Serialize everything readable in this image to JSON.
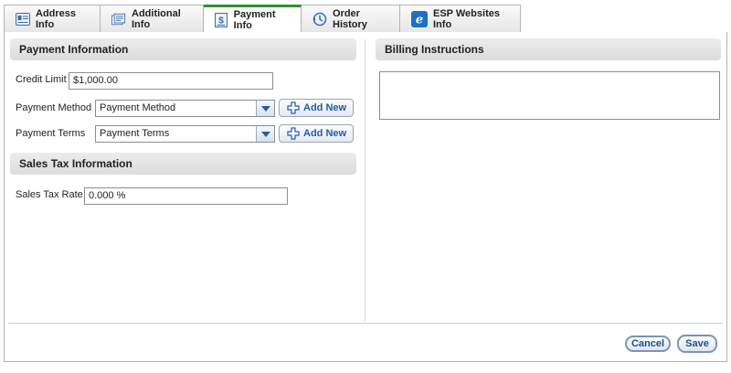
{
  "tabs": [
    {
      "label": "Address Info",
      "icon": "address-card-icon"
    },
    {
      "label": "Additional Info",
      "icon": "notes-icon"
    },
    {
      "label": "Payment Info",
      "icon": "payment-icon"
    },
    {
      "label": "Order History",
      "icon": "history-icon"
    },
    {
      "label": "ESP Websites Info",
      "icon": "esp-logo-icon"
    }
  ],
  "active_tab": "Payment Info",
  "accent_color": "#2d8f2d",
  "payment": {
    "title": "Payment Information",
    "credit_limit_label": "Credit Limit",
    "credit_limit_value": "$1,000.00",
    "payment_method_label": "Payment Method",
    "payment_method_value": "Payment Method",
    "payment_terms_label": "Payment Terms",
    "payment_terms_value": "Payment Terms",
    "add_new_label": "Add New"
  },
  "sales_tax": {
    "title": "Sales Tax Information",
    "rate_label": "Sales Tax Rate",
    "rate_value": "0.000 %"
  },
  "billing": {
    "title": "Billing Instructions",
    "value": ""
  },
  "footer": {
    "cancel_label": "Cancel",
    "save_label": "Save"
  }
}
